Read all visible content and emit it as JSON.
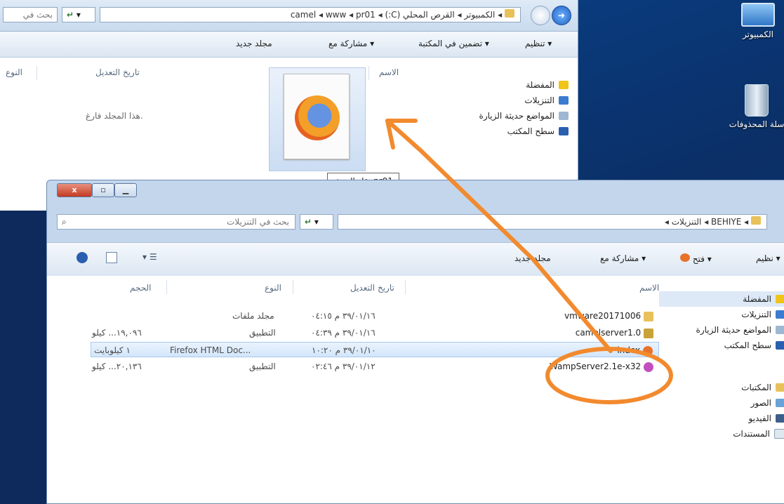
{
  "back_window": {
    "search_placeholder": "بحث في",
    "breadcrumb": [
      "pr01",
      "www",
      "camel",
      "القرص المحلي (C:)",
      "الكمبيوتر"
    ],
    "toolbar": {
      "organize": "تنظيم ▾",
      "include": "تضمين في المكتبة ▾",
      "share": "مشاركة مع ▾",
      "new_folder": "مجلد جديد"
    },
    "nav": [
      "المفضلة",
      "التنزيلات",
      "المواضع حديثة الزيارة",
      "سطح المكتب"
    ],
    "columns": {
      "name": "الاسم",
      "date": "تاريخ التعديل",
      "type": "النوع"
    },
    "empty_message": "هذا المجلد فارغ."
  },
  "drag_tooltip": "نقل إلى pr01",
  "front_window": {
    "search_placeholder": "بحث في التنزيلات",
    "breadcrumb": [
      "التنزيلات",
      "BEHIYE"
    ],
    "toolbar": {
      "organize": "نظيم ▾",
      "open": "فتح ▾",
      "share": "مشاركة مع ▾",
      "new_folder": "مجلد جديد"
    },
    "columns": {
      "name": "الاسم",
      "date": "تاريخ التعديل",
      "type": "النوع",
      "size": "الحجم"
    },
    "nav": [
      "المفضلة",
      "التنزيلات",
      "المواضع حديثة الزيارة",
      "سطح المكتب",
      "المكتبات",
      "الصور",
      "الفيديو",
      "المستندات"
    ],
    "files": [
      {
        "name": "vmware20171006",
        "date": "٣٩/٠١/١٦ م ٠٤:١٥",
        "type": "مجلد ملفات",
        "size": ""
      },
      {
        "name": "camelserver1.0",
        "date": "٣٩/٠١/١٦ م ٠٤:٣٩",
        "type": "التطبيق",
        "size": "١٩,٠٩٦... كيلو"
      },
      {
        "name": "index",
        "date": "٣٩/٠١/١٠ م ١٠:٢٠",
        "type": "Firefox HTML Doc...",
        "size": "١ كيلوبايت"
      },
      {
        "name": "WampServer2.1e-x32",
        "date": "٣٩/٠١/١٢ م ٠٢:٤٦",
        "type": "التطبيق",
        "size": "٢٠,١٣٦... كيلو"
      }
    ]
  },
  "desktop": {
    "icons": [
      "الكمبيوتر",
      "سلة المحذوفات"
    ]
  },
  "colors": {
    "annotation": "#f28a2e",
    "selection": "#d3e6fb"
  }
}
